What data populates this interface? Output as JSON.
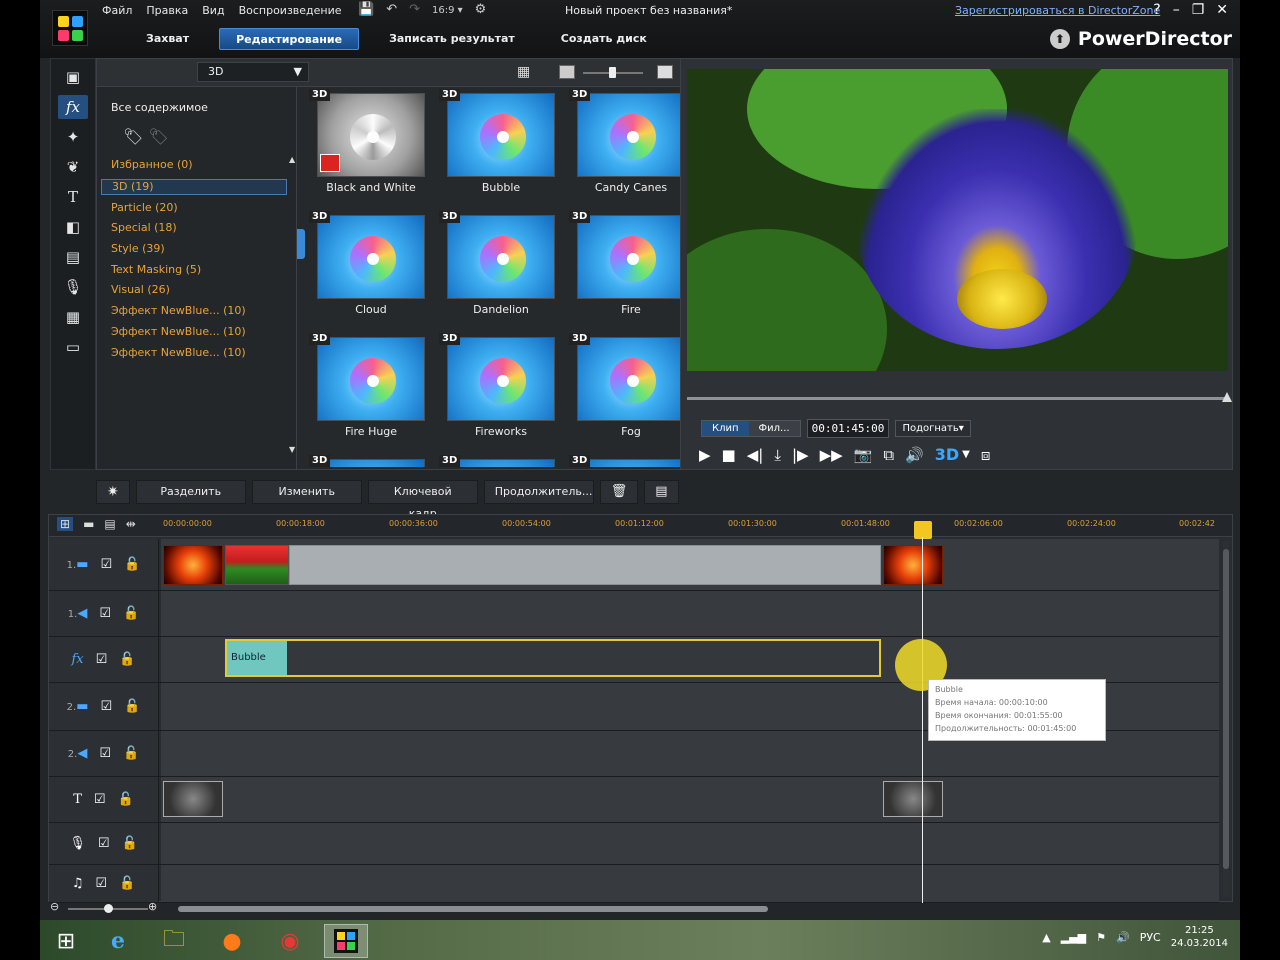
{
  "menu": [
    "Файл",
    "Правка",
    "Вид",
    "Воспроизведение"
  ],
  "window_title": "Новый проект без названия*",
  "register_link": "Зарегистрироваться в DirectorZone",
  "window_buttons": {
    "help": "?",
    "minimize": "–",
    "restore": "❐",
    "close": "✕"
  },
  "rooms": [
    {
      "label": "Захват",
      "active": false
    },
    {
      "label": "Редактирование",
      "active": true
    },
    {
      "label": "Записать результат",
      "active": false
    },
    {
      "label": "Создать диск",
      "active": false
    }
  ],
  "brand": "PowerDirector",
  "library": {
    "filter_value": "3D",
    "all_content": "Все содержимое",
    "categories": [
      {
        "label": "Избранное  (0)",
        "selected": false
      },
      {
        "label": "3D  (19)",
        "selected": true
      },
      {
        "label": "Particle  (20)",
        "selected": false
      },
      {
        "label": "Special  (18)",
        "selected": false
      },
      {
        "label": "Style  (39)",
        "selected": false
      },
      {
        "label": "Text Masking  (5)",
        "selected": false
      },
      {
        "label": "Visual  (26)",
        "selected": false
      },
      {
        "label": "Эффект NewBlue...  (10)",
        "selected": false
      },
      {
        "label": "Эффект NewBlue...  (10)",
        "selected": false
      },
      {
        "label": "Эффект NewBlue...  (10)",
        "selected": false
      }
    ],
    "badge": "3D",
    "effects": [
      {
        "label": "Black and White",
        "style": "gray"
      },
      {
        "label": "Bubble",
        "style": "blue"
      },
      {
        "label": "Candy Canes",
        "style": "blue"
      },
      {
        "label": "Cloud",
        "style": "blue"
      },
      {
        "label": "Dandelion",
        "style": "blue"
      },
      {
        "label": "Fire",
        "style": "blue"
      },
      {
        "label": "Fire Huge",
        "style": "blue"
      },
      {
        "label": "Fireworks",
        "style": "blue"
      },
      {
        "label": "Fog",
        "style": "blue"
      }
    ]
  },
  "preview": {
    "mode_clip": "Клип",
    "mode_film": "Фил...",
    "timecode": "00:01:45:00",
    "fit": "Подогнать▾",
    "threed": "3D"
  },
  "edit_tools": [
    "Разделить",
    "Изменить",
    "Ключевой кадр",
    "Продолжитель..."
  ],
  "ruler_ticks": [
    "00:00:00:00",
    "00:00:18:00",
    "00:00:36:00",
    "00:00:54:00",
    "00:01:12:00",
    "00:01:30:00",
    "00:01:48:00",
    "00:02:06:00",
    "00:02:24:00",
    "00:02:42"
  ],
  "tracks": [
    {
      "num": "1.",
      "icon": "▬",
      "name": "video-track-1"
    },
    {
      "num": "1.",
      "icon": "◀⃒",
      "name": "audio-track-1"
    },
    {
      "num": "",
      "icon": "fx",
      "name": "fx-track"
    },
    {
      "num": "2.",
      "icon": "▬",
      "name": "video-track-2"
    },
    {
      "num": "2.",
      "icon": "◀⃒",
      "name": "audio-track-2"
    },
    {
      "num": "",
      "icon": "T",
      "name": "title-track"
    },
    {
      "num": "",
      "icon": "🎙",
      "name": "voice-track"
    },
    {
      "num": "",
      "icon": "♫",
      "name": "music-track"
    }
  ],
  "fx_clip_label": "Bubble",
  "tooltip": [
    "Bubble",
    "Время начала: 00:00:10:00",
    "Время окончания: 00:01:55:00",
    "Продолжительность: 00:01:45:00"
  ],
  "taskbar": {
    "lang": "РУС",
    "time": "21:25",
    "date": "24.03.2014"
  }
}
